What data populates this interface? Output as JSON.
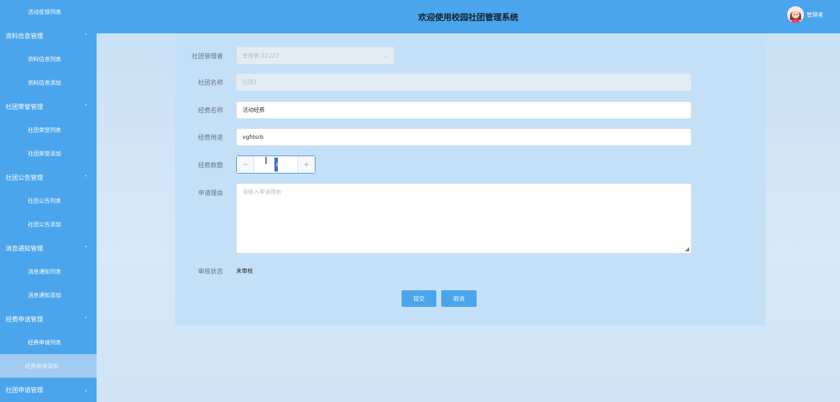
{
  "header": {
    "title": "欢迎使用校园社团管理系统",
    "user_name": "管理者"
  },
  "sidebar": {
    "entries": [
      {
        "type": "item",
        "label": "活动反馈列表"
      },
      {
        "type": "group",
        "label": "资料信息管理",
        "chevron": "up"
      },
      {
        "type": "item",
        "label": "资料信息列表"
      },
      {
        "type": "item",
        "label": "资料信息添加"
      },
      {
        "type": "group",
        "label": "社团荣誉管理",
        "chevron": "up"
      },
      {
        "type": "item",
        "label": "社团荣誉列表"
      },
      {
        "type": "item",
        "label": "社团荣誉添加"
      },
      {
        "type": "group",
        "label": "社团公告管理",
        "chevron": "up"
      },
      {
        "type": "item",
        "label": "社团公告列表"
      },
      {
        "type": "item",
        "label": "社团公告添加"
      },
      {
        "type": "group",
        "label": "消息通知管理",
        "chevron": "up"
      },
      {
        "type": "item",
        "label": "消息通知列表"
      },
      {
        "type": "item",
        "label": "消息通知添加"
      },
      {
        "type": "group",
        "label": "经费申请管理",
        "chevron": "up"
      },
      {
        "type": "item",
        "label": "经费申请列表"
      },
      {
        "type": "item",
        "label": "经费申请添加",
        "active": true
      },
      {
        "type": "group",
        "label": "社团申请管理",
        "chevron": "down"
      }
    ]
  },
  "form": {
    "manager": {
      "label": "社团管理者",
      "value": "管理者-22222"
    },
    "club_name": {
      "label": "社团名称",
      "value": "社团1"
    },
    "fund_name": {
      "label": "经费名称",
      "value": "活动经费"
    },
    "fund_usage": {
      "label": "经费用途",
      "value": "vgfdsrb"
    },
    "fund_amount": {
      "label": "经费数额",
      "value": "0",
      "minus": "−",
      "plus": "+"
    },
    "reason": {
      "label": "申请理由",
      "placeholder": "请输入申请理由"
    },
    "review_status": {
      "label": "审核状态",
      "value": "未审核"
    },
    "submit_label": "提交",
    "cancel_label": "取消"
  },
  "colors": {
    "primary": "#4aa5ec",
    "active_menu": "#a3ccf2",
    "panel": "#c4e0f7"
  },
  "icons": {
    "chevron_up": "⌃",
    "chevron_down": "⌄",
    "select_arrow": "⌄",
    "ibeam": "I",
    "resize": "◢"
  }
}
